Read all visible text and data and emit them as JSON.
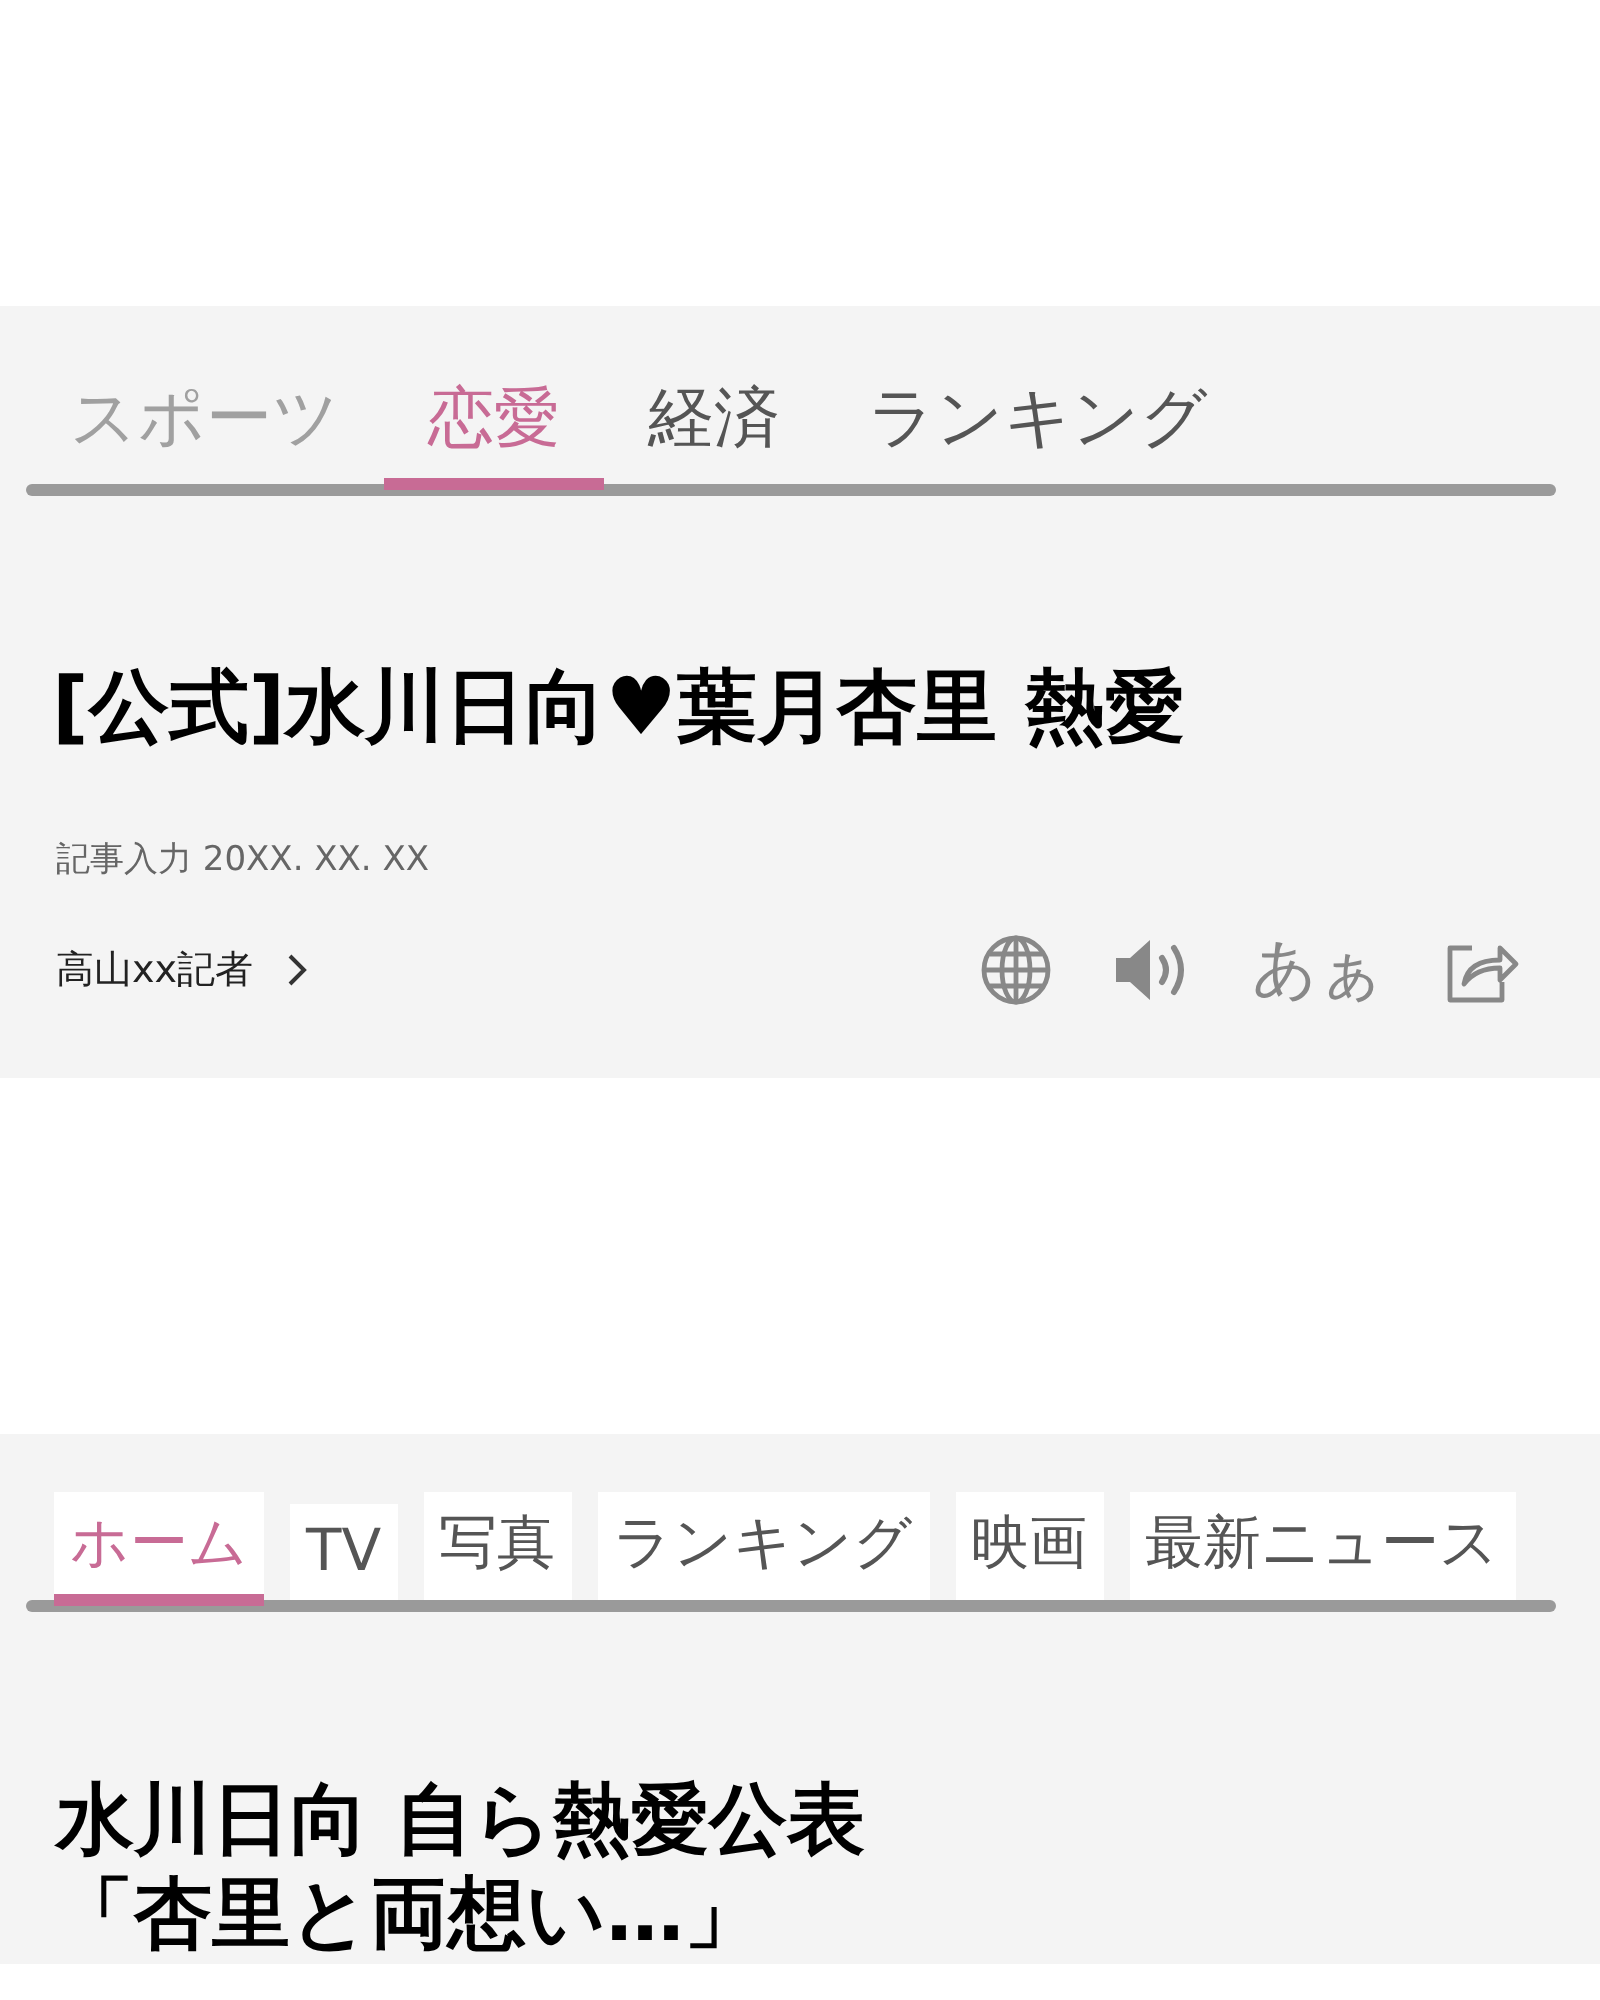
{
  "panels": [
    {
      "kind": "plain",
      "tabs": [
        {
          "label": "スポーツ",
          "selected": false,
          "faded": true
        },
        {
          "label": "恋愛",
          "selected": true,
          "faded": false
        },
        {
          "label": "経済",
          "selected": false,
          "faded": false
        },
        {
          "label": "ランキング",
          "selected": false,
          "faded": false
        }
      ],
      "headline": "[公式]水川日向♥葉月杏里 熱愛",
      "dateline": "記事入力 20XX. XX. XX",
      "author": "高山xx記者",
      "font_size_button": "あぁ"
    },
    {
      "kind": "boxed",
      "tabs": [
        {
          "label": "ホーム",
          "selected": true,
          "faded": false
        },
        {
          "label": "TV",
          "selected": false,
          "faded": false
        },
        {
          "label": "写真",
          "selected": false,
          "faded": false
        },
        {
          "label": "ランキング",
          "selected": false,
          "faded": false
        },
        {
          "label": "映画",
          "selected": false,
          "faded": false
        },
        {
          "label": "最新ニュース",
          "selected": false,
          "faded": false
        }
      ],
      "headline_lines": [
        "水川日向 自ら熱愛公表",
        "「杏里と両想い…」"
      ]
    }
  ]
}
